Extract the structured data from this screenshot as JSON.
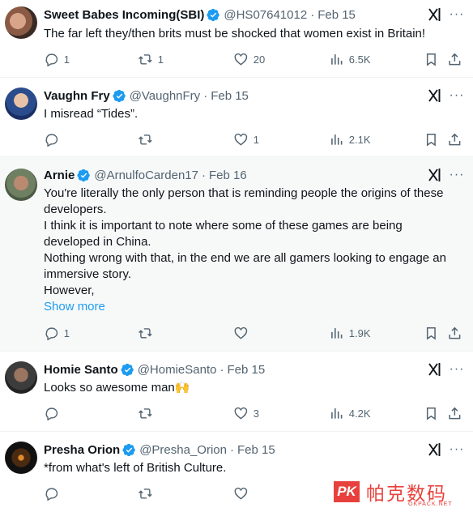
{
  "colors": {
    "accent": "#1d9bf0",
    "muted": "#536471",
    "text": "#0f1419",
    "verified": "#1d9bf0",
    "watermark": "#e8413d"
  },
  "icons": [
    "verified-badge-icon",
    "grok-icon",
    "more-icon",
    "reply-icon",
    "retweet-icon",
    "like-icon",
    "views-icon",
    "bookmark-icon",
    "share-icon"
  ],
  "tweets": [
    {
      "name": "Sweet Babes Incoming(SBI)",
      "handle": "@HS07641012",
      "date": "Feb 15",
      "text": [
        "The far left they/then brits must be shocked that  women exist in Britain!"
      ],
      "replies": "1",
      "reposts": "1",
      "likes": "20",
      "views": "6.5K"
    },
    {
      "name": "Vaughn Fry",
      "handle": "@VaughnFry",
      "date": "Feb 15",
      "text": [
        "I misread “Tides”."
      ],
      "replies": "",
      "reposts": "",
      "likes": "1",
      "views": "2.1K"
    },
    {
      "name": "Arnie",
      "handle": "@ArnulfoCarden17",
      "date": "Feb 16",
      "text": [
        "You're literally the only person that is reminding people the origins of these developers.",
        "I think it is important to note where some of these games are being developed in China.",
        "Nothing wrong with that, in the end we are all gamers looking to engage an immersive story.",
        "However,"
      ],
      "show_more": "Show more",
      "replies": "1",
      "reposts": "",
      "likes": "",
      "views": "1.9K"
    },
    {
      "name": "Homie Santo",
      "handle": "@HomieSanto",
      "date": "Feb 15",
      "text": [
        "Looks so awesome man🙌"
      ],
      "replies": "",
      "reposts": "",
      "likes": "3",
      "views": "4.2K"
    },
    {
      "name": "Presha Orion",
      "handle": "@Presha_Orion",
      "date": "Feb 15",
      "text": [
        "*from what's left of British Culture."
      ],
      "replies": "",
      "reposts": "",
      "likes": "",
      "views": ""
    }
  ],
  "separator": "·",
  "watermark": {
    "badge": "PK",
    "chinese": "帕克数码",
    "sub": "OKPACK.NET"
  }
}
